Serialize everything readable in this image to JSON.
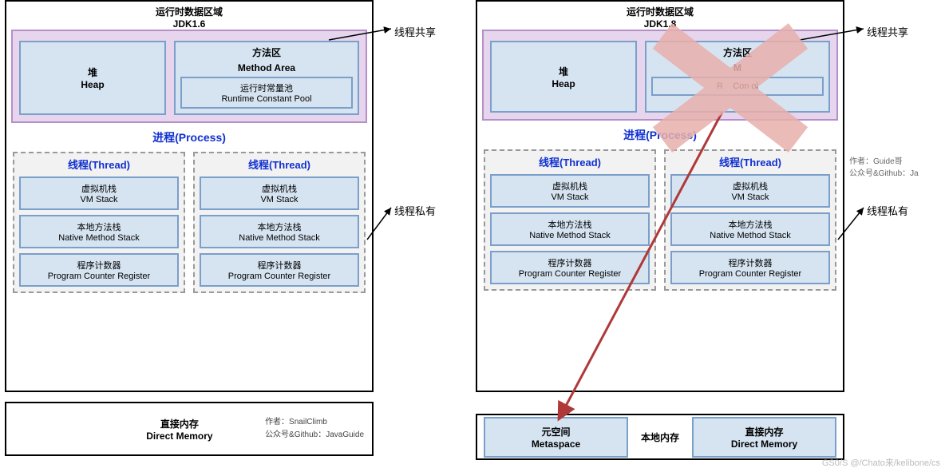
{
  "left": {
    "runtime_title_cn": "运行时数据区域",
    "jdk": "JDK1.6",
    "heap_cn": "堆",
    "heap_en": "Heap",
    "method_cn": "方法区",
    "method_en": "Method Area",
    "constpool_cn": "运行时常量池",
    "constpool_en": "Runtime Constant Pool",
    "process": "进程(Process)",
    "thread": "线程(Thread)",
    "vmstack_cn": "虚拟机栈",
    "vmstack_en": "VM Stack",
    "native_cn": "本地方法栈",
    "native_en": "Native Method Stack",
    "pcr_cn": "程序计数器",
    "pcr_en": "Program Counter Register",
    "direct_cn": "直接内存",
    "direct_en": "Direct Memory",
    "credits1": "作者：SnailClimb",
    "credits2": "公众号&Github：JavaGuide"
  },
  "right": {
    "runtime_title_cn": "运行时数据区域",
    "jdk": "JDK1.8",
    "heap_cn": "堆",
    "heap_en": "Heap",
    "method_cn": "方法区",
    "method_en": "M",
    "constpool_cn": "R",
    "constpool_en": "Con        ol",
    "process": "进程(Process)",
    "thread": "线程(Thread)",
    "vmstack_cn": "虚拟机栈",
    "vmstack_en": "VM Stack",
    "native_cn": "本地方法栈",
    "native_en": "Native Method Stack",
    "pcr_cn": "程序计数器",
    "pcr_en": "Program Counter Register",
    "meta_cn": "元空间",
    "meta_en": "Metaspace",
    "localmem": "本地内存",
    "direct_cn": "直接内存",
    "direct_en": "Direct Memory",
    "credits1": "作者：Guide哥",
    "credits2": "公众号&Github：Ja"
  },
  "labels": {
    "thread_shared": "线程共享",
    "thread_private": "线程私有"
  },
  "watermark": "GS0/S @/Chato来/kelibone/cs"
}
